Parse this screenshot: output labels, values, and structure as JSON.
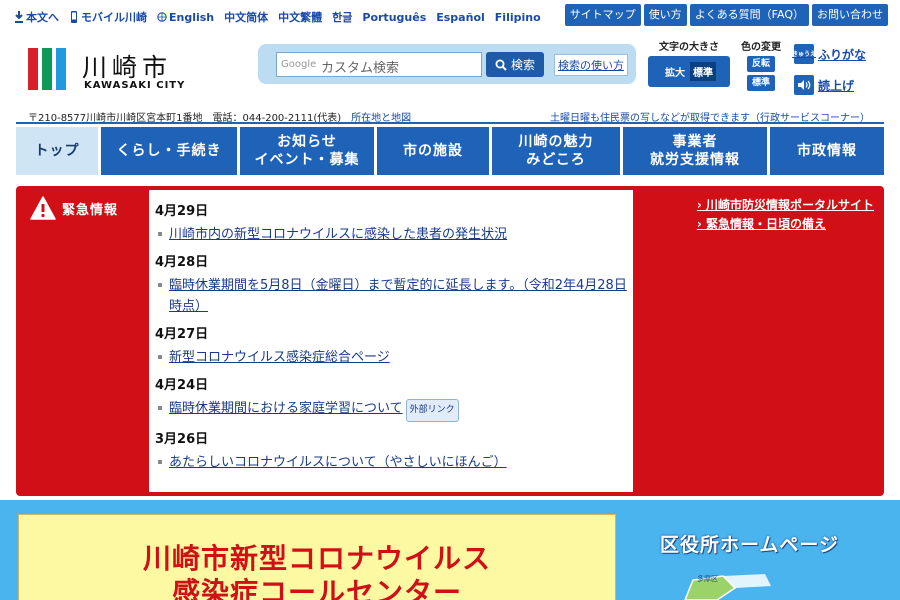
{
  "header": {
    "lang_links": [
      "本文へ",
      "モバイル川崎",
      "English",
      "中文简体",
      "中文繁體",
      "한글",
      "Português",
      "Español",
      "Filipino"
    ],
    "util_links": [
      "サイトマップ",
      "使い方",
      "よくある質問（FAQ）",
      "お問い合わせ"
    ]
  },
  "logo": {
    "jp": "川崎市",
    "en": "KAWASAKI CITY",
    "bar_colors": [
      "#d8202a",
      "#0e9a57",
      "#1d9bdc"
    ]
  },
  "search": {
    "placeholder": "カスタム検索",
    "google": "Google",
    "button": "検索",
    "help": "検索の使い方"
  },
  "font_size": {
    "label": "文字の大きさ",
    "enlarge": "拡大",
    "standard": "標準"
  },
  "color_change": {
    "label": "色の変更",
    "invert": "反転",
    "standard": "標準"
  },
  "tools": {
    "furigana_icon": "きゅうえ",
    "furigana": "ふりがな",
    "read_aloud": "読上げ"
  },
  "address": {
    "text": "〒210-8577川崎市川崎区宮本町1番地　電話：044-200-2111(代表)",
    "map_link": "所在地と地図",
    "service": "土曜日曜も住民票の写しなどが取得できます（行政サービスコーナー）"
  },
  "nav": [
    {
      "label": "トップ"
    },
    {
      "label": "くらし・手続き"
    },
    {
      "label": "お知らせ\nイベント・募集"
    },
    {
      "label": "市の施設"
    },
    {
      "label": "川崎の魅力\nみどころ"
    },
    {
      "label": "事業者\n就労支援情報"
    },
    {
      "label": "市政情報"
    }
  ],
  "emergency": {
    "heading": "緊急情報",
    "items": [
      {
        "date": "4月29日",
        "text": "川崎市内の新型コロナウイルスに感染した患者の発生状況",
        "external": ""
      },
      {
        "date": "4月28日",
        "text": "臨時休業期間を5月8日（金曜日）まで暫定的に延長します。（令和2年4月28日時点）",
        "external": ""
      },
      {
        "date": "4月27日",
        "text": "新型コロナウイルス感染症総合ページ",
        "external": ""
      },
      {
        "date": "4月24日",
        "text": "臨時休業期間における家庭学習について",
        "external": "外部リンク"
      },
      {
        "date": "3月26日",
        "text": "あたらしいコロナウイルスについて（やさしいにほんご）",
        "external": ""
      }
    ],
    "links": [
      "川崎市防災情報ポータルサイト",
      "緊急情報・日頃の備え"
    ]
  },
  "bottom": {
    "call_center_line1": "川崎市新型コロナウイルス",
    "call_center_line2": "感染症コールセンター",
    "ward_title": "区役所ホームページ",
    "ward_label": "多摩区"
  }
}
